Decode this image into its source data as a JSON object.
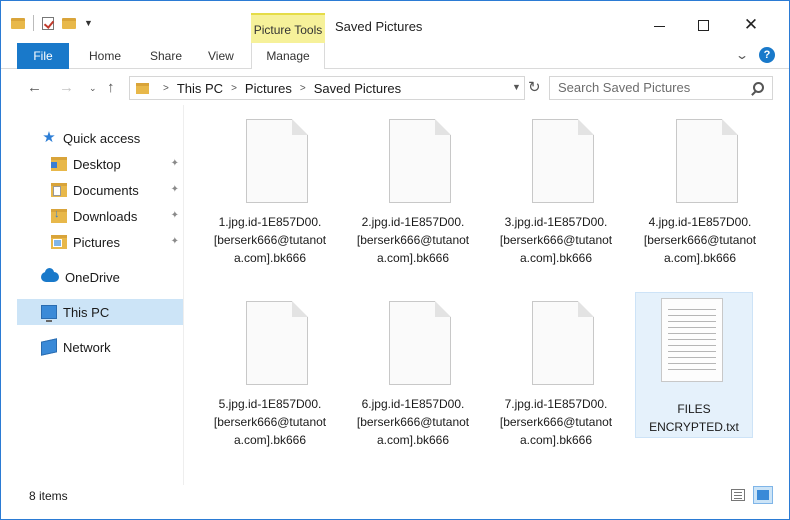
{
  "window": {
    "title": "Saved Pictures",
    "picture_tools_label": "Picture Tools",
    "minimize_glyph": "—",
    "maximize_glyph": "☐",
    "close_glyph": "✕"
  },
  "ribbon": {
    "file_tab": "File",
    "tabs": [
      "Home",
      "Share",
      "View",
      "Manage"
    ],
    "help_glyph": "?",
    "collapse_glyph": "⌄"
  },
  "address_bar": {
    "breadcrumbs": [
      "This PC",
      "Pictures",
      "Saved Pictures"
    ],
    "search_placeholder": "Search Saved Pictures"
  },
  "nav_glyphs": {
    "back": "←",
    "forward": "→",
    "recent": "⌄",
    "up": "↑",
    "refresh": "↻",
    "pin": "📌",
    "crumb_separator": ">"
  },
  "navigation_pane": {
    "quick_access": "Quick access",
    "items": [
      {
        "label": "Desktop",
        "pinned": true
      },
      {
        "label": "Documents",
        "pinned": true
      },
      {
        "label": "Downloads",
        "pinned": true
      },
      {
        "label": "Pictures",
        "pinned": true
      }
    ],
    "onedrive": "OneDrive",
    "this_pc": "This PC",
    "network": "Network"
  },
  "files": [
    {
      "name": "1.jpg.id-1E857D00.[berserk666@tutanota.com].bk666",
      "icon": "generic-file-icon"
    },
    {
      "name": "2.jpg.id-1E857D00.[berserk666@tutanota.com].bk666",
      "icon": "generic-file-icon"
    },
    {
      "name": "3.jpg.id-1E857D00.[berserk666@tutanota.com].bk666",
      "icon": "generic-file-icon"
    },
    {
      "name": "4.jpg.id-1E857D00.[berserk666@tutanota.com].bk666",
      "icon": "generic-file-icon"
    },
    {
      "name": "5.jpg.id-1E857D00.[berserk666@tutanota.com].bk666",
      "icon": "generic-file-icon"
    },
    {
      "name": "6.jpg.id-1E857D00.[berserk666@tutanota.com].bk666",
      "icon": "generic-file-icon"
    },
    {
      "name": "7.jpg.id-1E857D00.[berserk666@tutanota.com].bk666",
      "icon": "generic-file-icon"
    },
    {
      "name": "FILES ENCRYPTED.txt",
      "icon": "text-file-icon",
      "selected": true
    }
  ],
  "status_bar": {
    "item_count": "8 items"
  },
  "colors": {
    "accent": "#1979ca",
    "selection": "#cce4f7",
    "picture_tools": "#f6f19a"
  }
}
